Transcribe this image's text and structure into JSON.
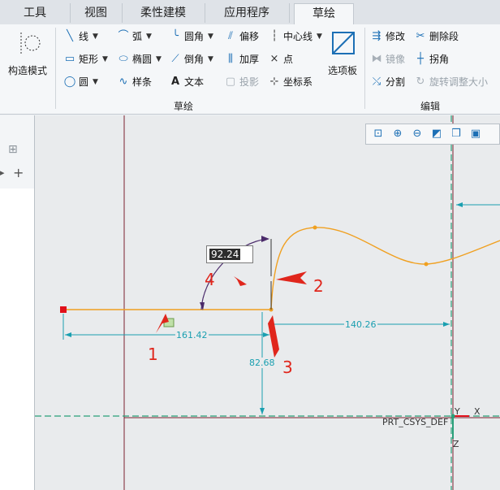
{
  "tabs": [
    "工具",
    "视图",
    "柔性建模",
    "应用程序",
    "草绘"
  ],
  "active_tab": "草绘",
  "ribbon": {
    "construct_mode": "构造模式",
    "sketch_items": [
      {
        "label": "线",
        "icon": "line-icon",
        "dropdown": true
      },
      {
        "label": "弧",
        "icon": "arc-icon",
        "dropdown": true
      },
      {
        "label": "圆角",
        "icon": "fillet-icon",
        "dropdown": true
      },
      {
        "label": "偏移",
        "icon": "offset-icon",
        "dropdown": false
      },
      {
        "label": "中心线",
        "icon": "centerline-icon",
        "dropdown": true
      },
      {
        "label": "矩形",
        "icon": "rectangle-icon",
        "dropdown": true
      },
      {
        "label": "椭圆",
        "icon": "ellipse-icon",
        "dropdown": true
      },
      {
        "label": "倒角",
        "icon": "chamfer-icon",
        "dropdown": true
      },
      {
        "label": "加厚",
        "icon": "thicken-icon",
        "dropdown": false
      },
      {
        "label": "点",
        "icon": "point-icon",
        "dropdown": false
      },
      {
        "label": "圆",
        "icon": "circle-icon",
        "dropdown": true
      },
      {
        "label": "样条",
        "icon": "spline-icon",
        "dropdown": false
      },
      {
        "label": "文本",
        "icon": "text-icon",
        "dropdown": false
      },
      {
        "label": "投影",
        "icon": "project-icon",
        "dropdown": false,
        "disabled": true
      },
      {
        "label": "坐标系",
        "icon": "csys-icon",
        "dropdown": false
      }
    ],
    "palette": "选项板",
    "sketch_group": "草绘",
    "edit_items": [
      {
        "label": "修改",
        "icon": "modify-icon"
      },
      {
        "label": "删除段",
        "icon": "delete-segment-icon"
      },
      {
        "label": "镜像",
        "icon": "mirror-icon",
        "disabled": true
      },
      {
        "label": "拐角",
        "icon": "corner-icon"
      },
      {
        "label": "分割",
        "icon": "divide-icon"
      },
      {
        "label": "旋转调整大小",
        "icon": "rotate-resize-icon",
        "disabled": true
      }
    ],
    "edit_group": "编辑"
  },
  "dimensions": {
    "input_value": "92.24",
    "horizontal_left": "161.42",
    "horizontal_right": "140.26",
    "vertical": "82.68"
  },
  "annotations": [
    "1",
    "2",
    "3",
    "4"
  ],
  "csys_name": "PRT_CSYS_DEF",
  "axis_labels": {
    "y": "Y",
    "x": "X",
    "z": "Z"
  },
  "colors": {
    "sketch": "#f0a020",
    "dimension": "#1a9fb0",
    "annotation": "#e0261c",
    "axis": "#2aa07a"
  }
}
